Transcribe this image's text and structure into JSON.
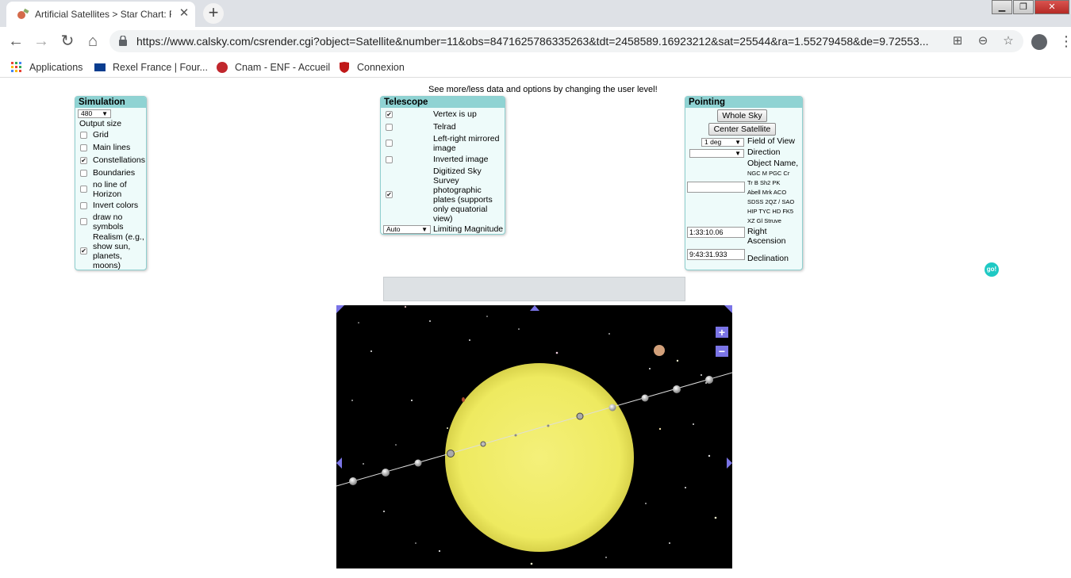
{
  "browser": {
    "tab_title": "Artificial Satellites > Star Chart: R",
    "new_tab": "+",
    "url": "https://www.calsky.com/csrender.cgi?object=Satellite&number=11&obs=8471625786335263&tdt=2458589.16923212&sat=25544&ra=1.55279458&de=9.72553...",
    "bookmarks": [
      "Applications",
      "Rexel France | Four...",
      "Cnam - ENF - Accueil",
      "Connexion"
    ]
  },
  "page": {
    "notice": "See more/less data and options by changing the user level!",
    "simulation": {
      "title": "Simulation",
      "size_value": "480",
      "size_label": "Output size",
      "options": [
        {
          "label": "Grid",
          "checked": false
        },
        {
          "label": "Main lines",
          "checked": false
        },
        {
          "label": "Constellations",
          "checked": true
        },
        {
          "label": "Boundaries",
          "checked": false
        },
        {
          "label": "no line of Horizon",
          "checked": false
        },
        {
          "label": "Invert colors",
          "checked": false
        },
        {
          "label": "draw no symbols",
          "checked": false
        },
        {
          "label": "Realism (e.g., show sun, planets, moons)",
          "checked": true
        }
      ]
    },
    "telescope": {
      "title": "Telescope",
      "options": [
        {
          "label": "Vertex is up",
          "checked": true
        },
        {
          "label": "Telrad",
          "checked": false
        },
        {
          "label": "Left-right mirrored image",
          "checked": false
        },
        {
          "label": "Inverted image",
          "checked": false
        },
        {
          "label": "Digitized Sky Survey photographic plates (supports only equatorial view)",
          "checked": true
        }
      ],
      "limiting_value": "Auto",
      "limiting_label": "Limiting Magnitude"
    },
    "pointing": {
      "title": "Pointing",
      "whole_sky": "Whole Sky",
      "center_satellite": "Center Satellite",
      "fov_value": "1 deg",
      "fov_label": "Field of View",
      "direction_value": "",
      "direction_label": "Direction",
      "object_name_label": "Object Name,",
      "object_catalogs": [
        "NGC M PGC Cr",
        "Tr B Sh2 PK",
        "Abell Mrk ACO",
        "SDSS 2QZ / SAO",
        "HIP TYC HD FK5",
        "XZ Gl Struve"
      ],
      "object_name_value": "",
      "ra_value": "1:33:10.06",
      "ra_label": "Right Ascension",
      "dec_value": "9:43:31.933",
      "dec_label": "Declination"
    },
    "go": "go!",
    "zoom_in": "+",
    "zoom_out": "−"
  },
  "colors": {
    "panel_bg": "#eefbfa",
    "panel_title": "#8fd3d3",
    "sun": "#f2ee6a",
    "nav_markers": "#7a74e6",
    "go": "#1ec9c4"
  }
}
